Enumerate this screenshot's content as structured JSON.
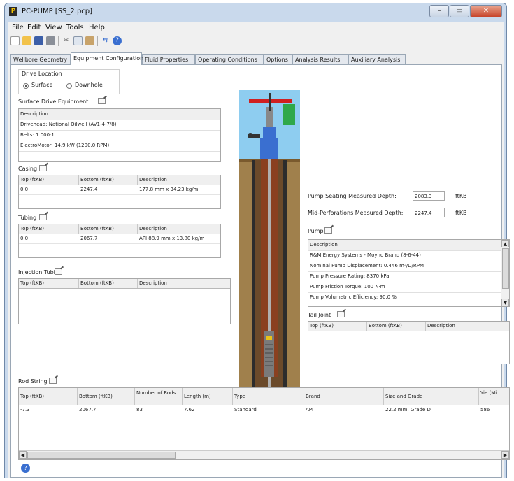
{
  "window": {
    "title": "PC-PUMP [SS_2.pcp]",
    "min": "–",
    "max": "▭",
    "close": "✕"
  },
  "menu": [
    "File",
    "Edit",
    "View",
    "Tools",
    "Help"
  ],
  "toolbar": [
    "new-icon",
    "open-icon",
    "save-icon",
    "print-icon",
    "cut-icon",
    "copy-icon",
    "paste-icon",
    "units-icon",
    "help-icon"
  ],
  "tabs": [
    "Wellbore Geometry",
    "Equipment Configuration",
    "Fluid Properties",
    "Operating Conditions",
    "Options",
    "Analysis Results",
    "Auxiliary Analysis"
  ],
  "drive_location": {
    "label": "Drive Location",
    "surface": "Surface",
    "downhole": "Downhole",
    "selected": "Surface"
  },
  "surface_drive": {
    "label": "Surface Drive Equipment",
    "header": "Description",
    "rows": [
      "Drivehead: National Oilwell (AV1-4-7/8)",
      "Belts: 1.000:1",
      "ElectroMotor: 14.9 kW (1200.0 RPM)"
    ]
  },
  "casing": {
    "label": "Casing",
    "columns": [
      "Top (ftKB)",
      "Bottom (ftKB)",
      "Description"
    ],
    "rows": [
      [
        "0.0",
        "2247.4",
        "177.8 mm x 34.23 kg/m"
      ]
    ]
  },
  "tubing": {
    "label": "Tubing",
    "columns": [
      "Top (ftKB)",
      "Bottom (ftKB)",
      "Description"
    ],
    "rows": [
      [
        "0.0",
        "2067.7",
        "API 88.9 mm x 13.80 kg/m"
      ]
    ]
  },
  "injection_tubing": {
    "label": "Injection Tubing",
    "columns": [
      "Top (ftKB)",
      "Bottom (ftKB)",
      "Description"
    ]
  },
  "pump_depths": {
    "seating_label": "Pump Seating Measured Depth:",
    "seating_value": "2083.3",
    "seating_unit": "ftKB",
    "perf_label": "Mid-Perforations Measured Depth:",
    "perf_value": "2247.4",
    "perf_unit": "ftKB"
  },
  "pump": {
    "label": "Pump",
    "header": "Description",
    "rows": [
      "R&M Energy Systems - Moyno Brand (8-6-44)",
      "Nominal Pump Displacement: 0.446 m³/D/RPM",
      "Pump Pressure Rating: 8370 kPa",
      "Pump Friction Torque: 100 N·m",
      "Pump Volumetric Efficiency: 90.0 %"
    ]
  },
  "tail_joint": {
    "label": "Tail Joint",
    "columns": [
      "Top (ftKB)",
      "Bottom (ftKB)",
      "Description"
    ]
  },
  "rod_string": {
    "label": "Rod String",
    "columns": [
      "Top (ftKB)",
      "Bottom (ftKB)",
      "Number of Rods",
      "Length (m)",
      "Type",
      "Brand",
      "Size and Grade",
      "Yie (Mi"
    ],
    "rows": [
      [
        "-7.3",
        "2067.7",
        "83",
        "7.62",
        "Standard",
        "API",
        "22.2 mm, Grade D",
        "586"
      ]
    ]
  },
  "colors": {
    "window_frame": "#c9d9ec",
    "sky": "#8ecdf0",
    "soil": "#a0804c",
    "casing": "#2c2c2c",
    "tubing": "#8a4020",
    "valve": "#3a6fd0",
    "motor": "#2fa84a",
    "horsehead": "#d02020"
  }
}
